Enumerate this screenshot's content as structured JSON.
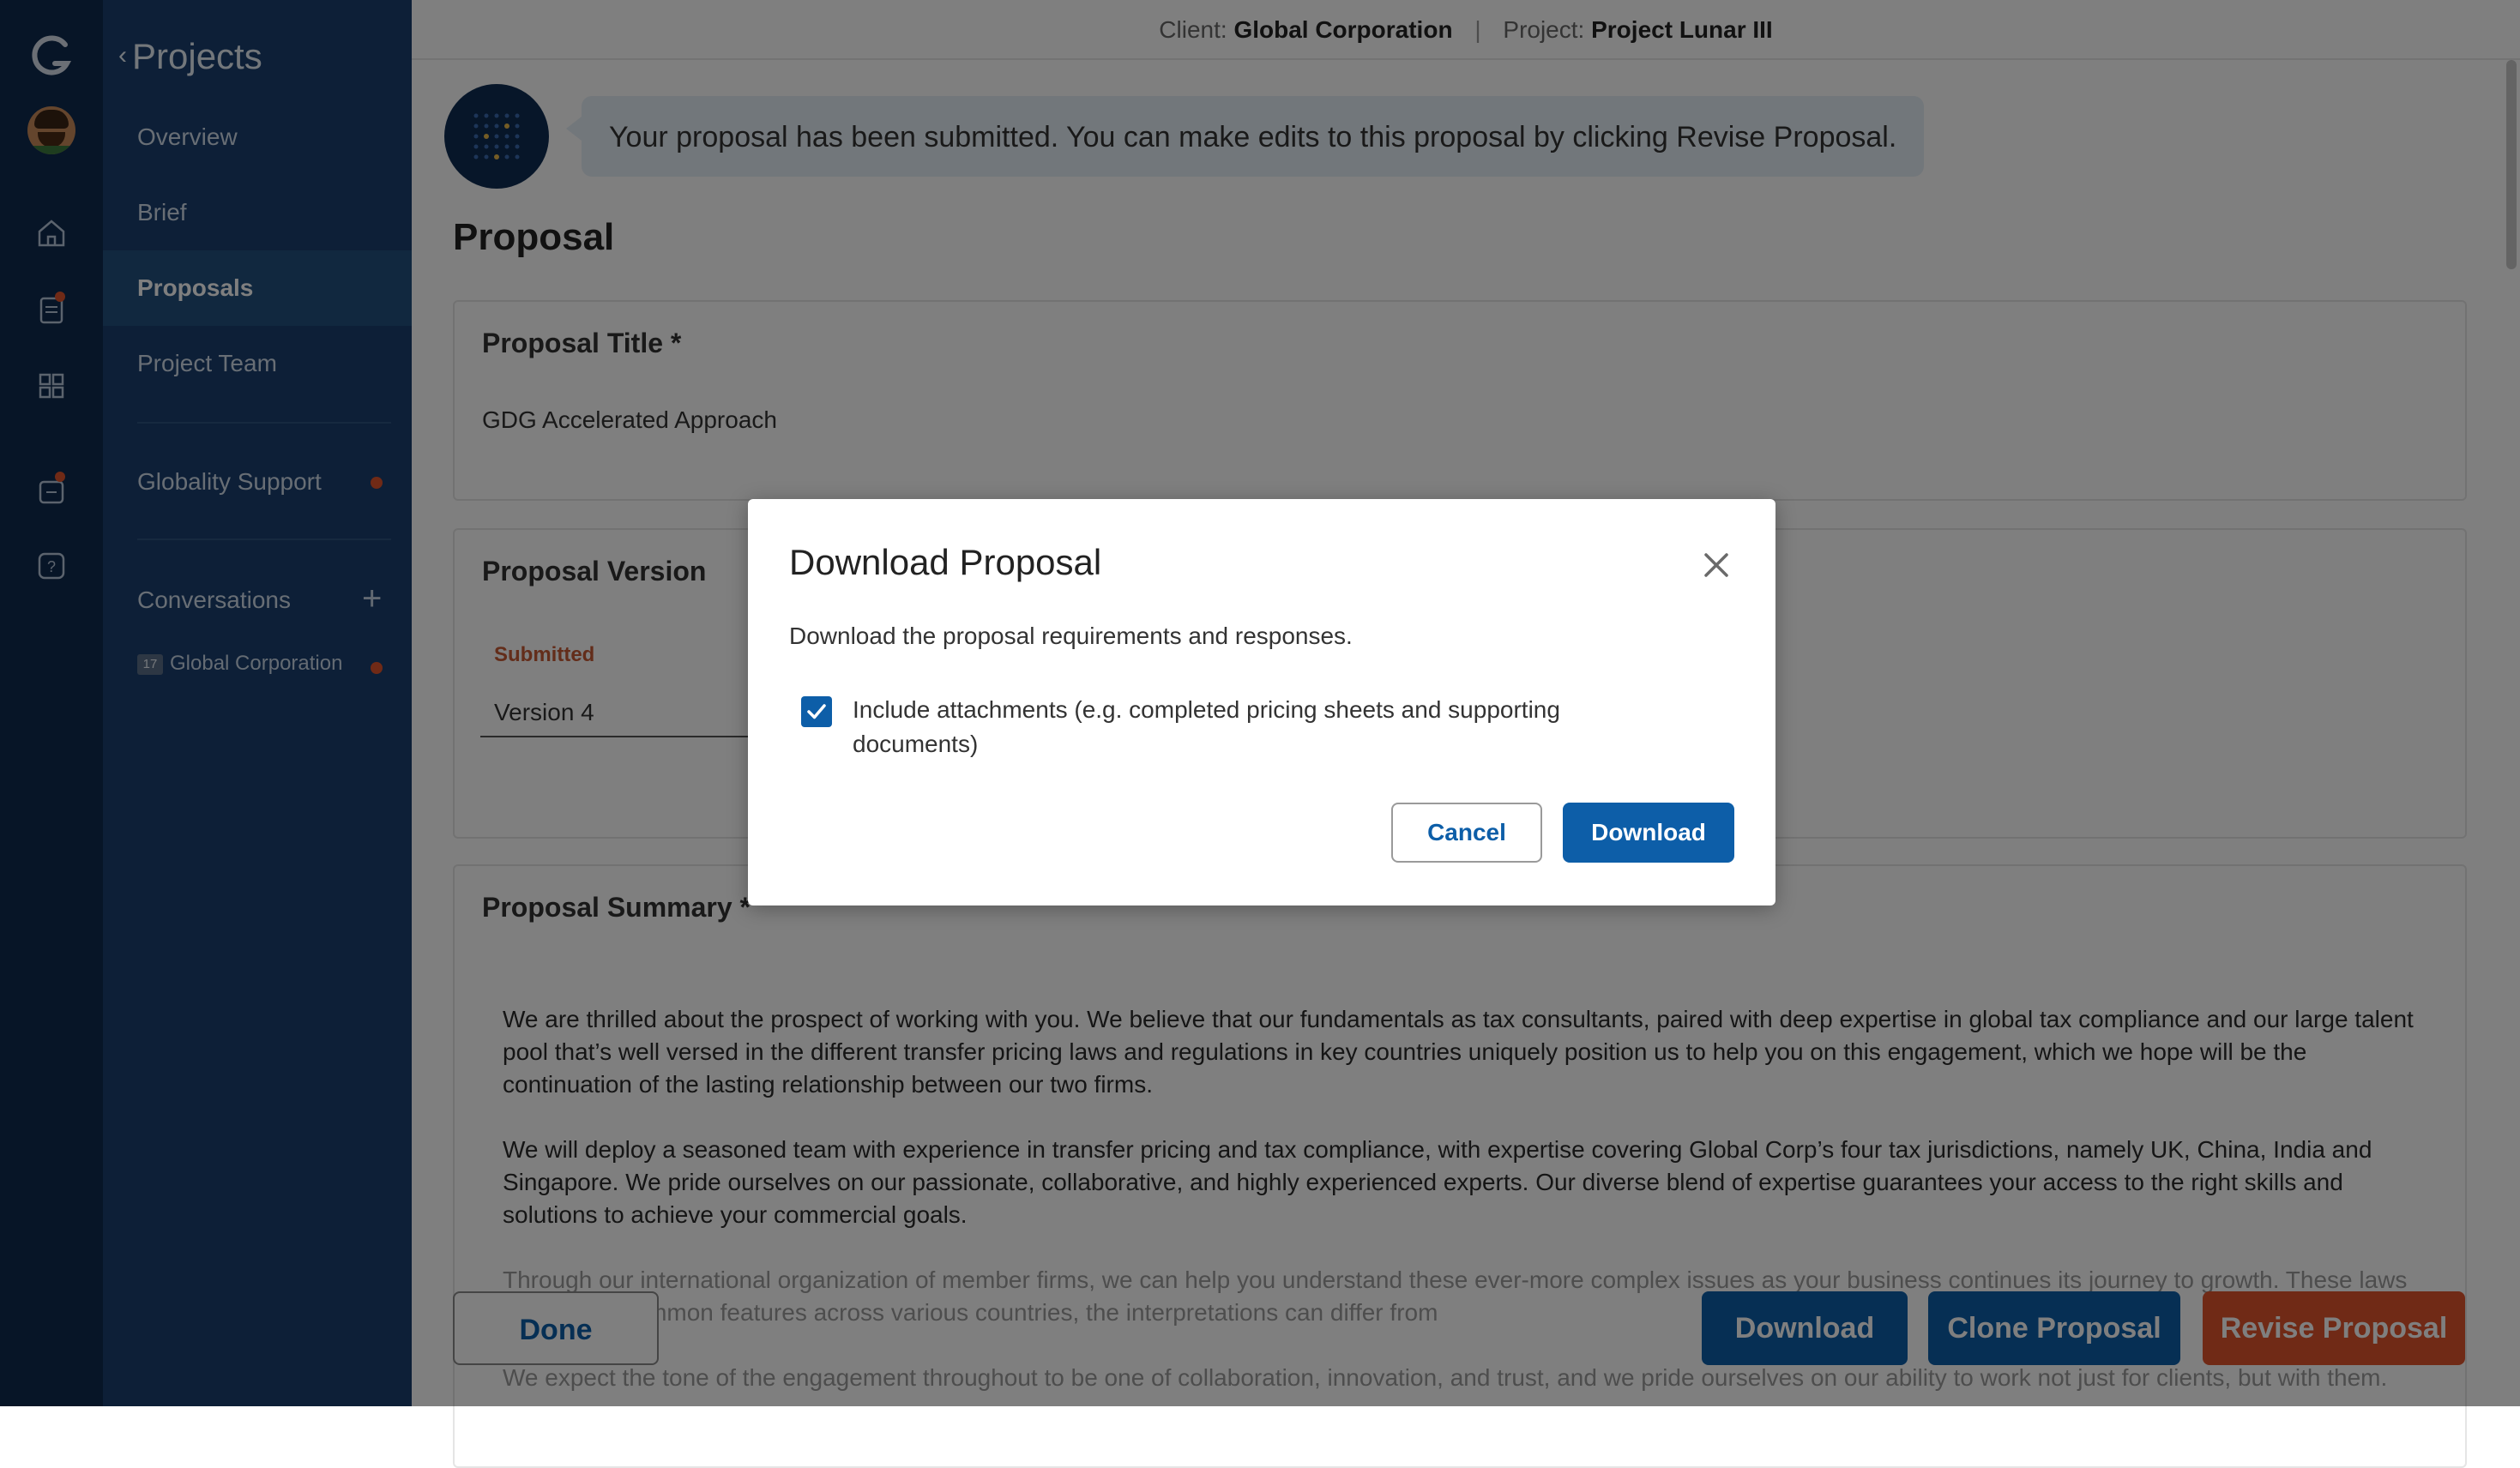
{
  "header": {
    "client_label": "Client:",
    "client_value": "Global Corporation",
    "project_label": "Project:",
    "project_value": "Project Lunar III"
  },
  "sidebar": {
    "back_label": "Projects",
    "items": [
      {
        "label": "Overview"
      },
      {
        "label": "Brief"
      },
      {
        "label": "Proposals"
      },
      {
        "label": "Project Team"
      },
      {
        "label": "Globality Support"
      },
      {
        "label": "Conversations"
      }
    ],
    "conversation": {
      "badge": "17",
      "label": "Global Corporation"
    }
  },
  "rail": {
    "icons": [
      "globality-logo",
      "avatar",
      "home-icon",
      "documents-icon",
      "apps-grid-icon",
      "support-chat-icon",
      "help-icon"
    ]
  },
  "notice": "Your proposal has been submitted. You can make edits to this proposal by clicking Revise Proposal.",
  "main": {
    "title": "Proposal",
    "proposal_title_label": "Proposal Title *",
    "proposal_title_value": "GDG Accelerated Approach",
    "proposal_version_label": "Proposal Version",
    "version_status": "Submitted",
    "version_value": "Version 4",
    "summary_label": "Proposal Summary *",
    "summary_p1": "We are thrilled about the prospect of working with you. We believe that our fundamentals as tax consultants, paired with deep expertise in global tax compliance and our large talent pool that’s well versed in the different transfer pricing laws and regulations in key countries uniquely position us to help you on this engagement, which we hope will be the continuation of the lasting relationship between our two firms.",
    "summary_p2": "We will deploy a seasoned team with experience in transfer pricing and tax compliance, with expertise covering Global Corp’s four tax jurisdictions, namely UK, China, India and Singapore. We pride ourselves on our passionate, collaborative, and highly experienced experts. Our diverse blend of expertise guarantees your access to the right skills and solutions to achieve your commercial goals.",
    "summary_p3": "Through our international organization of member firms, we can help you understand these ever-more complex issues as your business continues its journey to growth. These laws may share common features across various countries, the interpretations can differ from",
    "summary_p4": "We expect the tone of the engagement throughout to be one of collaboration, innovation, and trust, and we pride ourselves on our ability to work not just for clients, but with them."
  },
  "footer": {
    "done": "Done",
    "download": "Download",
    "clone": "Clone Proposal",
    "revise": "Revise Proposal"
  },
  "modal": {
    "title": "Download Proposal",
    "description": "Download the proposal requirements and responses.",
    "checkbox_label": "Include attachments (e.g. completed pricing sheets and supporting documents)",
    "checkbox_checked": true,
    "cancel": "Cancel",
    "download": "Download"
  },
  "colors": {
    "rail": "#0f2a4f",
    "sidebar": "#1a3f6e",
    "primary": "#0d5ea8",
    "accent": "#e0552d",
    "notice_bg": "#e5eef6"
  }
}
